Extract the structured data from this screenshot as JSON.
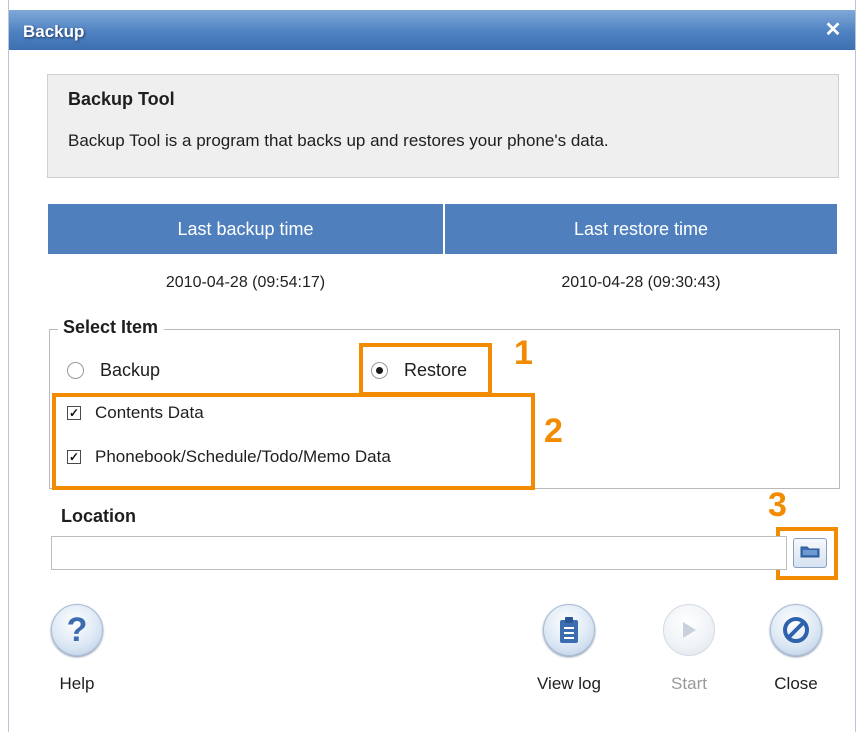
{
  "window": {
    "title": "Backup"
  },
  "info": {
    "title": "Backup Tool",
    "description": "Backup Tool is a program that backs up and restores your phone's data."
  },
  "times": {
    "backup_header": "Last backup time",
    "restore_header": "Last restore time",
    "backup_value": "2010-04-28 (09:54:17)",
    "restore_value": "2010-04-28 (09:30:43)"
  },
  "select_item": {
    "legend": "Select Item",
    "mode_options": [
      "Backup",
      "Restore"
    ],
    "selected_mode": "Restore",
    "checkboxes": [
      {
        "label": "Contents Data",
        "checked": true
      },
      {
        "label": "Phonebook/Schedule/Todo/Memo Data",
        "checked": true
      }
    ]
  },
  "location": {
    "label": "Location",
    "value": ""
  },
  "buttons": {
    "help": "Help",
    "view_log": "View log",
    "start": "Start",
    "close": "Close"
  },
  "annotations": [
    "1",
    "2",
    "3"
  ],
  "colors": {
    "accent": "#4f80bd",
    "annotation": "#f28b00"
  },
  "icons": {
    "close": "close-x-icon",
    "browse": "folder-icon",
    "help": "question-mark-icon",
    "view_log": "clipboard-icon",
    "start": "play-icon",
    "close_button": "prohibited-circle-icon"
  }
}
